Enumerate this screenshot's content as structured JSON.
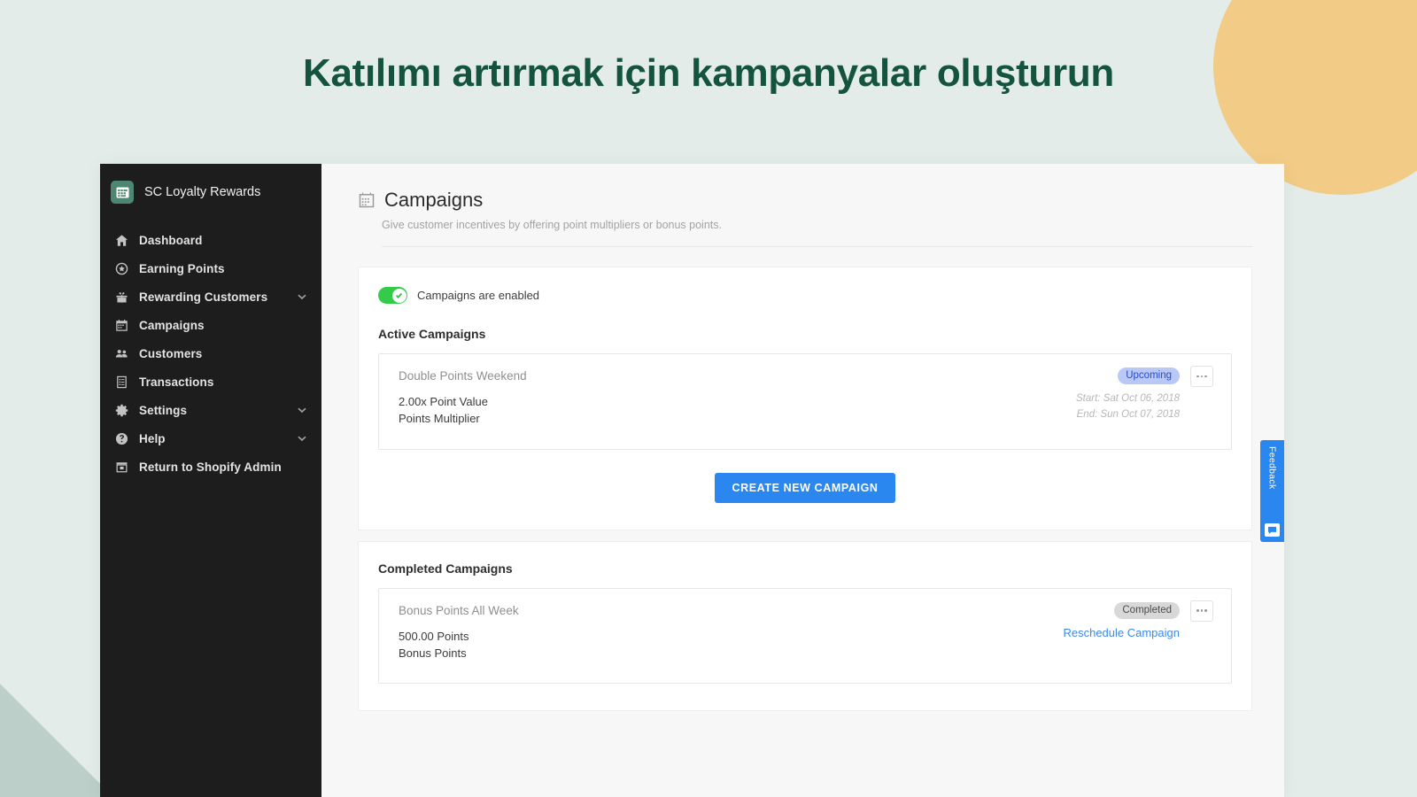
{
  "headline": "Katılımı artırmak için kampanyalar oluşturun",
  "colors": {
    "background": "#e4ecea",
    "headline": "#14543f",
    "accent_circle": "#f2cb86",
    "accent_triangle": "#bccfc9",
    "sidebar": "#1d1d1d",
    "primary_button": "#2b87f0",
    "toggle_on": "#33cc4a",
    "badge_upcoming_bg": "#b9c8f5",
    "badge_upcoming_text": "#2a4dc4",
    "badge_completed_bg": "#d8d8d8",
    "link": "#3c8ae8"
  },
  "sidebar": {
    "brand": {
      "name": "SC Loyalty Rewards",
      "icon": "calendar-app-icon"
    },
    "items": [
      {
        "label": "Dashboard",
        "icon": "home-icon",
        "expandable": false
      },
      {
        "label": "Earning Points",
        "icon": "star-circle-icon",
        "expandable": false
      },
      {
        "label": "Rewarding Customers",
        "icon": "gift-icon",
        "expandable": true
      },
      {
        "label": "Campaigns",
        "icon": "calendar-icon",
        "expandable": false
      },
      {
        "label": "Customers",
        "icon": "people-icon",
        "expandable": false
      },
      {
        "label": "Transactions",
        "icon": "list-document-icon",
        "expandable": false
      },
      {
        "label": "Settings",
        "icon": "gear-icon",
        "expandable": true
      },
      {
        "label": "Help",
        "icon": "question-circle-icon",
        "expandable": true
      },
      {
        "label": "Return to Shopify Admin",
        "icon": "store-icon",
        "expandable": false
      }
    ]
  },
  "page": {
    "title": "Campaigns",
    "title_icon": "calendar-icon",
    "subtitle": "Give customer incentives by offering point multipliers or bonus points."
  },
  "toggle": {
    "label": "Campaigns are enabled",
    "state": "on"
  },
  "active_section": {
    "title": "Active Campaigns",
    "campaign": {
      "name": "Double Points Weekend",
      "value": "2.00x Point Value",
      "type": "Points Multiplier",
      "badge": "Upcoming",
      "start": "Start: Sat Oct 06, 2018",
      "end": "End: Sun Oct 07, 2018"
    },
    "cta": "CREATE NEW CAMPAIGN"
  },
  "completed_section": {
    "title": "Completed Campaigns",
    "campaign": {
      "name": "Bonus Points All Week",
      "value": "500.00 Points",
      "type": "Bonus Points",
      "badge": "Completed",
      "action_link": "Reschedule Campaign"
    }
  },
  "feedback": {
    "label": "Feedback",
    "icon": "chat-bubble-icon"
  }
}
